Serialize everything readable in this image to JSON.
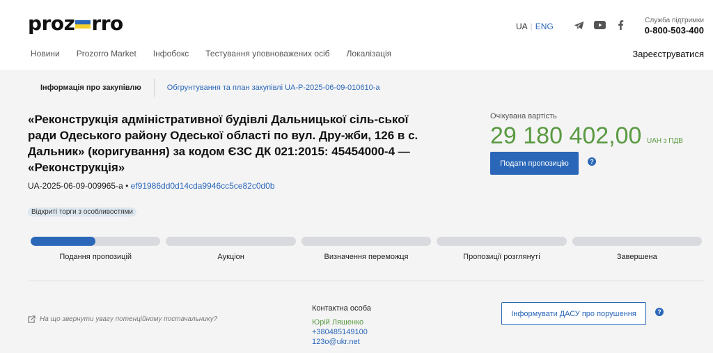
{
  "header": {
    "logo_left": "proz",
    "logo_right": "rro",
    "lang_ua": "UA",
    "lang_sep": "|",
    "lang_eng": "ENG",
    "support_label": "Служба підтримки",
    "support_phone": "0-800-503-400",
    "nav": [
      "Новини",
      "Prozorro Market",
      "Інфобокс",
      "Тестування уповноважених осіб",
      "Локалізація"
    ],
    "register": "Зареєструватися",
    "icons": [
      "telegram-icon",
      "youtube-icon",
      "facebook-icon"
    ]
  },
  "tabs": {
    "info": "Інформація про закупівлю",
    "plan": "Обгрунтування та план закупівлі UA-P-2025-06-09-010610-a"
  },
  "tender": {
    "title": "«Реконструкція адміністративної будівлі Дальницької сіль-ської ради Одеського району Одеської області по вул. Дру-жби, 126 в с. Дальник» (коригування) за кодом ЄЗС ДК 021:2015: 45454000-4 — «Реконструкція»",
    "id": "UA-2025-06-09-009965-a",
    "bullet": "•",
    "hash": "ef91986dd0d14cda9946cc5ce82c0d0b",
    "badge": "Відкриті торги з особливостями",
    "price_label": "Очікувана вартість",
    "price": "29 180 402,00",
    "currency": "UAH з ПДВ",
    "submit_label": "Подати пропозицію",
    "help": "?"
  },
  "progress": {
    "stages": [
      "Подання пропозицій",
      "Аукціон",
      "Визначення переможця",
      "Пропозиції розглянуті",
      "Завершена"
    ],
    "first_stage_fill": 0.5
  },
  "footer": {
    "hint": "На що звернути увагу потенційному постачальнику?",
    "contact_label": "Контактна особа",
    "contact_name": "Юрій Ляшенко",
    "contact_phone": "+380485149100",
    "contact_email": "123o@ukr.net",
    "report_label": "Інформувати ДАСУ про порушення"
  },
  "colors": {
    "accent": "#2a67b8",
    "price": "#5a9a41",
    "background": "#f4f4f5"
  }
}
